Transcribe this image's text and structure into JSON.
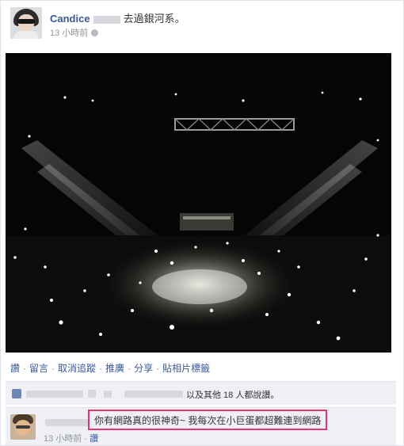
{
  "post": {
    "author_name": "Candice",
    "action_text": "去過銀河系。",
    "timestamp": "13 小時前",
    "privacy_icon": "globe-icon"
  },
  "actions": [
    {
      "label": "讚"
    },
    {
      "label": "留言"
    },
    {
      "label": "取消追蹤"
    },
    {
      "label": "推廣"
    },
    {
      "label": "分享"
    },
    {
      "label": "貼相片標籤"
    }
  ],
  "likes": {
    "text": "以及其他 18 人都說讚。"
  },
  "comment": {
    "text": "你有網路真的很神奇~ 我每次在小巨蛋都超難連到網路",
    "timestamp": "13 小時前",
    "like_label": "讚"
  },
  "colors": {
    "link": "#3b5998",
    "highlight_border": "#e8356e",
    "panel": "#eef0f6"
  }
}
